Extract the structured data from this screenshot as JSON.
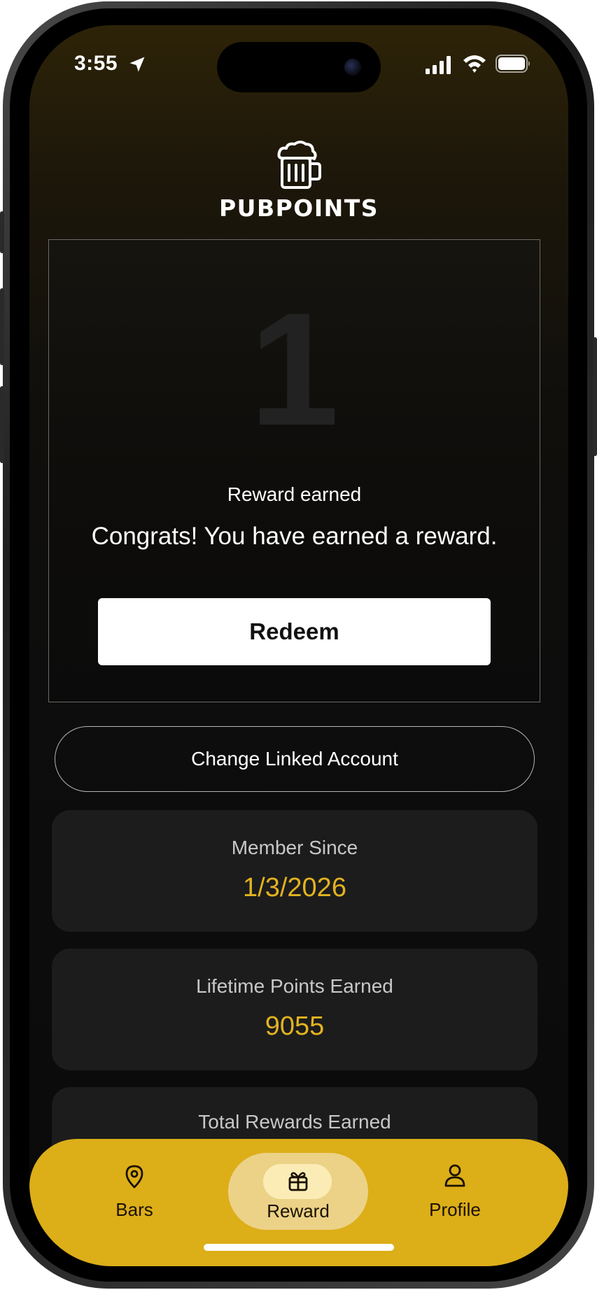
{
  "status_bar": {
    "time": "3:55"
  },
  "header": {
    "brand": "PUBPOINTS",
    "logo_icon": "beer-mug-icon"
  },
  "reward_card": {
    "count": "1",
    "title": "Reward earned",
    "message": "Congrats! You have earned a reward.",
    "redeem_label": "Redeem"
  },
  "account": {
    "change_label": "Change Linked Account"
  },
  "stats": [
    {
      "label": "Member Since",
      "value": "1/3/2026"
    },
    {
      "label": "Lifetime Points Earned",
      "value": "9055"
    },
    {
      "label": "Total Rewards Earned",
      "value": ""
    }
  ],
  "tab_bar": {
    "tabs": [
      {
        "label": "Bars",
        "icon": "map-pin-icon",
        "active": false
      },
      {
        "label": "Reward",
        "icon": "gift-icon",
        "active": true
      },
      {
        "label": "Profile",
        "icon": "person-icon",
        "active": false
      }
    ]
  },
  "colors": {
    "accent": "#dcae18",
    "value_gold": "#e3b320",
    "card_bg": "#1c1c1c"
  }
}
